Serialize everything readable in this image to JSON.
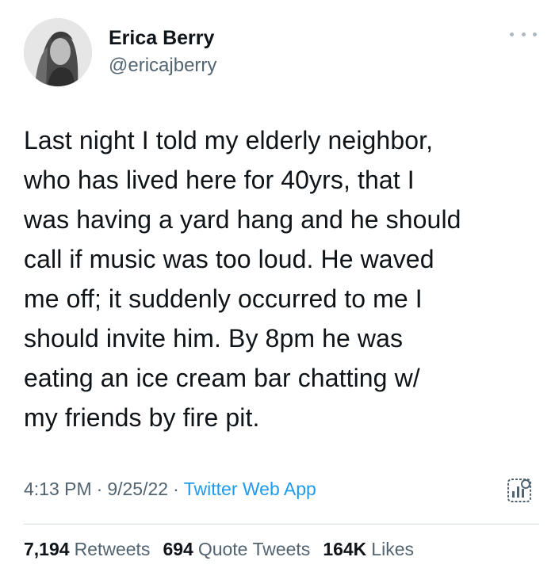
{
  "author": {
    "name": "Erica Berry",
    "handle": "@ericajberry"
  },
  "tweet": {
    "text": "Last night I told my elderly neighbor,\nwho has lived here for 40yrs, that I\nwas having a yard hang and he should\ncall if music was too loud. He waved\nme off; it suddenly occurred to me I\nshould invite him. By 8pm he was\neating an ice cream bar chatting w/\nmy friends by fire pit."
  },
  "meta": {
    "time": "4:13 PM",
    "date": "9/25/22",
    "separator": "·",
    "source": "Twitter Web App"
  },
  "stats": {
    "retweets_count": "7,194",
    "retweets_label": "Retweets",
    "quotes_count": "694",
    "quotes_label": "Quote Tweets",
    "likes_count": "164K",
    "likes_label": "Likes"
  },
  "icons": {
    "more": "more-options-icon",
    "analytics": "tweet-analytics-icon"
  },
  "colors": {
    "text": "#0f1419",
    "secondary": "#536471",
    "link": "#1d9bf0"
  }
}
